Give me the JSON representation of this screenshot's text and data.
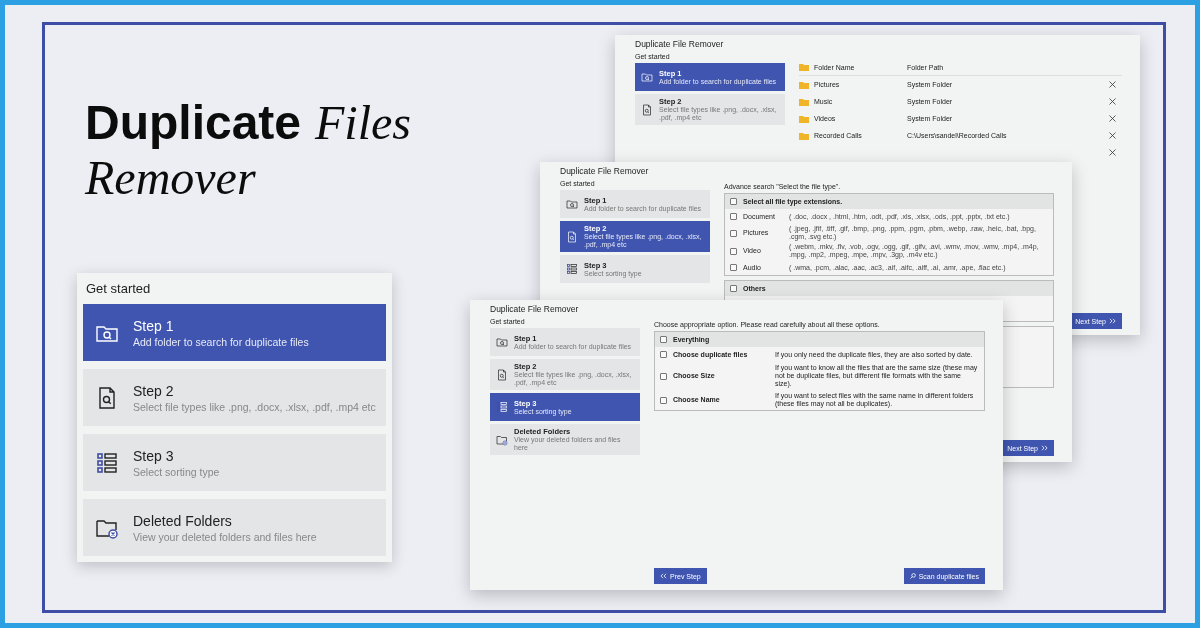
{
  "headline": {
    "lines": [
      [
        "Duplicate",
        "Files"
      ],
      [
        "Remover"
      ]
    ]
  },
  "panel": {
    "heading": "Get started",
    "steps": [
      {
        "title": "Step 1",
        "subtitle": "Add folder to search for duplicate files",
        "selected": true
      },
      {
        "title": "Step 2",
        "subtitle": "Select file types like .png, .docx, .xlsx, .pdf, .mp4 etc",
        "selected": false
      },
      {
        "title": "Step 3",
        "subtitle": "Select sorting type",
        "selected": false
      },
      {
        "title": "Deleted Folders",
        "subtitle": "View your deleted folders and files here",
        "selected": false
      }
    ]
  },
  "windows": [
    {
      "kind": "folders",
      "title": "Duplicate File Remover",
      "heading": "Get started",
      "steps": [
        {
          "title": "Step 1",
          "subtitle": "Add folder to search for duplicate files",
          "selected": true
        },
        {
          "title": "Step 2",
          "subtitle": "Select file types like .png, .docx, .xlsx, .pdf, .mp4 etc",
          "selected": false
        }
      ],
      "columns": [
        "Folder Name",
        "Folder Path"
      ],
      "rows": [
        {
          "name": "Pictures",
          "path": "System Folder"
        },
        {
          "name": "Music",
          "path": "System Folder"
        },
        {
          "name": "Videos",
          "path": "System Folder"
        },
        {
          "name": "Recorded Calls",
          "path": "C:\\Users\\sandel\\Recorded Calls"
        },
        {}
      ],
      "next_button": "Next Step"
    },
    {
      "kind": "file_types",
      "title": "Duplicate File Remover",
      "heading": "Get started",
      "steps": [
        {
          "title": "Step 1",
          "subtitle": "Add folder to search for duplicate files",
          "selected": false
        },
        {
          "title": "Step 2",
          "subtitle": "Select file types like .png, .docx, .xlsx, .pdf, .mp4 etc",
          "selected": true
        },
        {
          "title": "Step 3",
          "subtitle": "Select sorting type",
          "selected": false
        }
      ],
      "caption": "Advance search \"Select the file type\".",
      "select_all": {
        "label": "Select all file type extensions.",
        "checked": false
      },
      "types": [
        {
          "label": "Document",
          "extensions": "( .doc, .docx , .html, .htm, .odt, .pdf, .xls, .xlsx, .ods, .ppt, .pptx, .txt etc.)",
          "checked": false
        },
        {
          "label": "Pictures",
          "extensions": "( .jpeg, .jfif, .tiff, .gif, .bmp, .png, .ppm, .pgm, .pbm, .webp, .raw, .heic, .bat, .bpg, .cgm, .svg etc.)",
          "checked": false
        },
        {
          "label": "Video",
          "extensions": "( .webm, .mkv, .flv, .vob, .ogv, .ogg, .gif, .gifv, .avi, .wmv, .mov, .wmv, .mp4, .m4p, .mpg, .mp2, .mpeg, .mpe, .mpv, .3gp, .m4v etc.)",
          "checked": false
        },
        {
          "label": "Audio",
          "extensions": "( .wma, .pcm, .alac, .aac, .ac3, .aif, .aifc, .aiff, .ai, .amr, .ape, .flac etc.)",
          "checked": false
        }
      ],
      "others": {
        "label": "Others",
        "checked": false
      },
      "next_button": "Next Step"
    },
    {
      "kind": "sorting",
      "title": "Duplicate File Remover",
      "heading": "Get started",
      "steps": [
        {
          "title": "Step 1",
          "subtitle": "Add folder to search for duplicate files",
          "selected": false
        },
        {
          "title": "Step 2",
          "subtitle": "Select file types like .png, .docx, .xlsx, .pdf, .mp4 etc",
          "selected": false
        },
        {
          "title": "Step 3",
          "subtitle": "Select sorting type",
          "selected": true
        },
        {
          "title": "Deleted Folders",
          "subtitle": "View your deleted folders and files here",
          "selected": false
        }
      ],
      "caption": "Choose appropriate option. Please read carefully about all these options.",
      "options": [
        {
          "label": "Everything",
          "checked": false
        },
        {
          "label": "Choose duplicate files",
          "description": "If you only need the duplicate files, they are also sorted by date.",
          "checked": false
        },
        {
          "label": "Choose Size",
          "description": "If you want to know all the files that are the same size (these may not be duplicate files, but different file formats with the same size).",
          "checked": false
        },
        {
          "label": "Choose Name",
          "description": "If you want to select files with the same name in different folders (these files may not all be duplicates).",
          "checked": false
        }
      ],
      "prev_button": "Prev Step",
      "scan_button": "Scan duplicate files"
    }
  ]
}
